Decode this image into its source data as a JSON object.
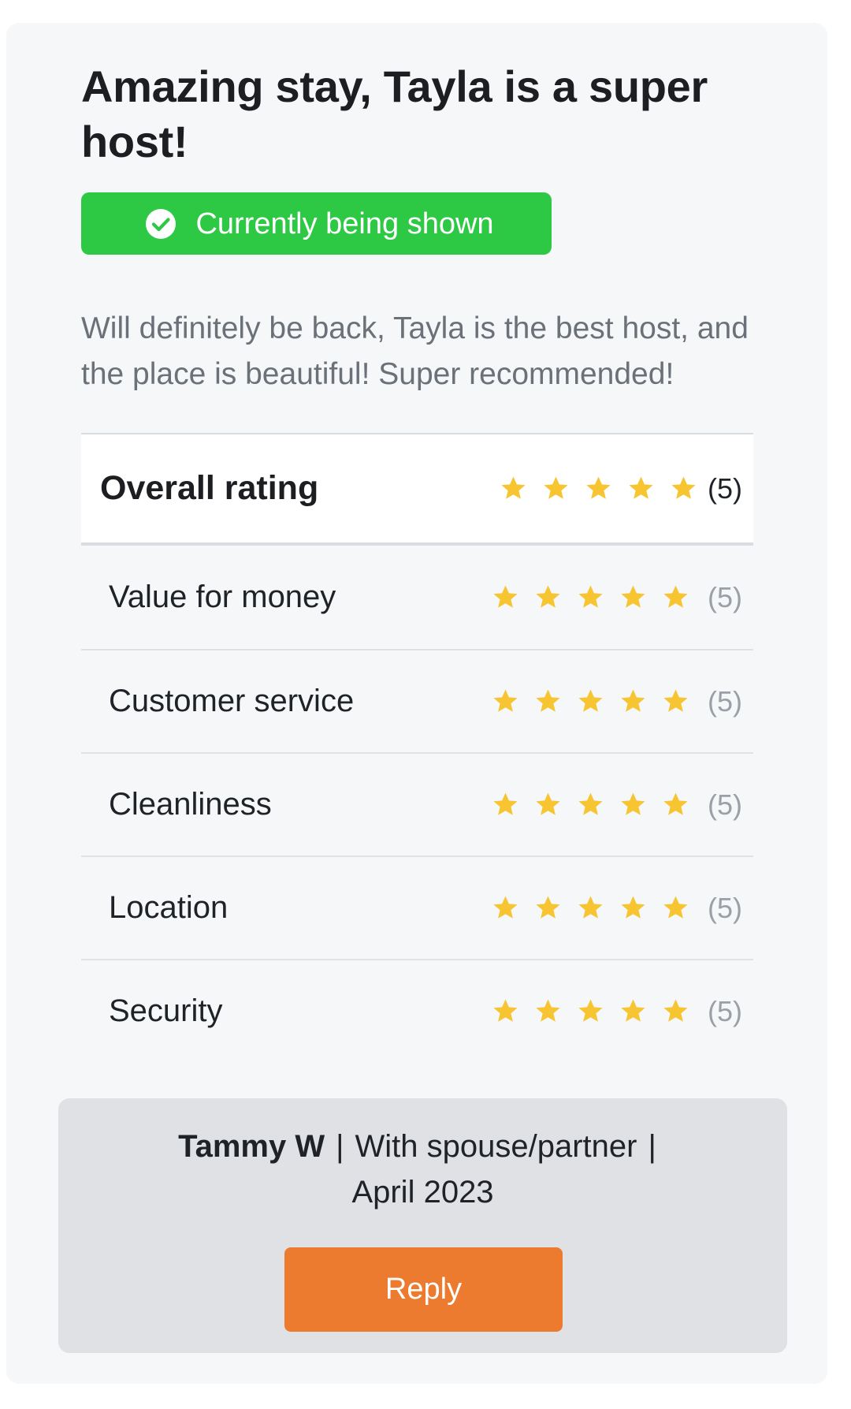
{
  "review": {
    "title": "Amazing stay, Tayla is a super host!",
    "status_badge": {
      "icon": "check-circle-icon",
      "label": "Currently being shown",
      "color": "#2ec944"
    },
    "text": "Will definitely be back, Tayla is the best host, and the place is beautiful! Super recommended!"
  },
  "ratings": {
    "star_color": "#f7c531",
    "overall": {
      "label": "Overall rating",
      "stars": 5,
      "max": 5,
      "count_text": "(5)"
    },
    "items": [
      {
        "label": "Value for money",
        "stars": 5,
        "max": 5,
        "count_text": "(5)"
      },
      {
        "label": "Customer service",
        "stars": 5,
        "max": 5,
        "count_text": "(5)"
      },
      {
        "label": "Cleanliness",
        "stars": 5,
        "max": 5,
        "count_text": "(5)"
      },
      {
        "label": "Location",
        "stars": 5,
        "max": 5,
        "count_text": "(5)"
      },
      {
        "label": "Security",
        "stars": 5,
        "max": 5,
        "count_text": "(5)"
      }
    ]
  },
  "reviewer": {
    "name": "Tammy W",
    "separator": "|",
    "travel_type": "With spouse/partner",
    "date": "April 2023"
  },
  "actions": {
    "reply_label": "Reply",
    "reply_color": "#ec7a2f"
  }
}
